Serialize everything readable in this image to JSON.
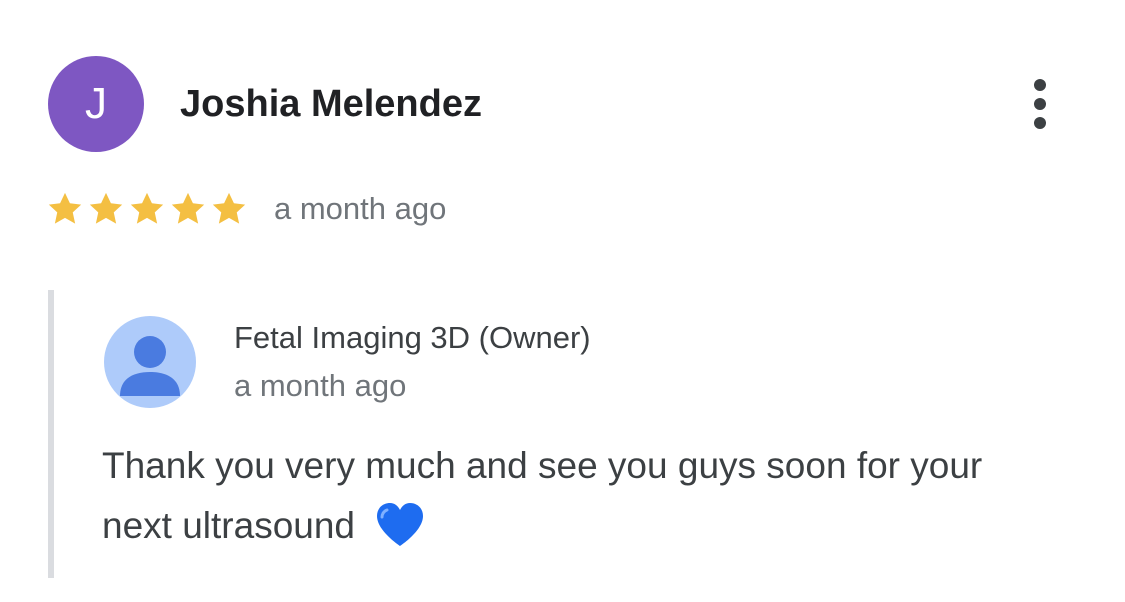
{
  "review": {
    "avatar_letter": "J",
    "avatar_color": "#7e57c2",
    "reviewer_name": "Joshia Melendez",
    "more_icon": "more-vert-icon",
    "rating": 5,
    "rating_max": 5,
    "star_color": "#f4bf42",
    "time_ago": "a month ago"
  },
  "reply": {
    "owner_avatar_icon": "person-icon",
    "owner_name": "Fetal Imaging 3D (Owner)",
    "time_ago": "a month ago",
    "text": "Thank you very much and see you guys soon for your next ultrasound",
    "emoji_icon": "blue-heart-icon",
    "heart_color": "#1e6cf0"
  }
}
